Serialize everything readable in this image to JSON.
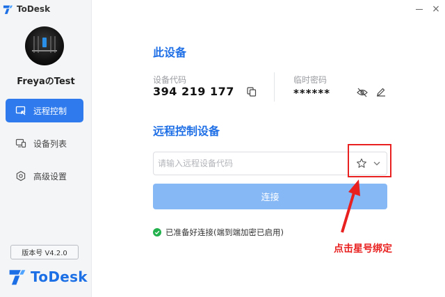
{
  "app": {
    "title": "ToDesk",
    "brand": "ToDesk",
    "version": "版本号 V4.2.0"
  },
  "user": {
    "name": "FreyaのTest"
  },
  "sidebar": {
    "items": [
      {
        "label": "远程控制",
        "icon": "remote-control-icon",
        "active": true
      },
      {
        "label": "设备列表",
        "icon": "device-list-icon",
        "active": false
      },
      {
        "label": "高级设置",
        "icon": "settings-icon",
        "active": false
      }
    ]
  },
  "this_device": {
    "title": "此设备",
    "code_label": "设备代码",
    "code": "394 219 177",
    "password_label": "临时密码",
    "password": "******"
  },
  "remote": {
    "title": "远程控制设备",
    "input_placeholder": "请输入远程设备代码",
    "input_value": "",
    "connect_label": "连接"
  },
  "status": {
    "text": "已准备好连接(端到端加密已启用)"
  },
  "annotation": {
    "text": "点击星号绑定"
  },
  "colors": {
    "accent": "#1f6fe6",
    "button": "#86b8f6",
    "annotation": "#e8201f",
    "ok": "#22b14c"
  }
}
